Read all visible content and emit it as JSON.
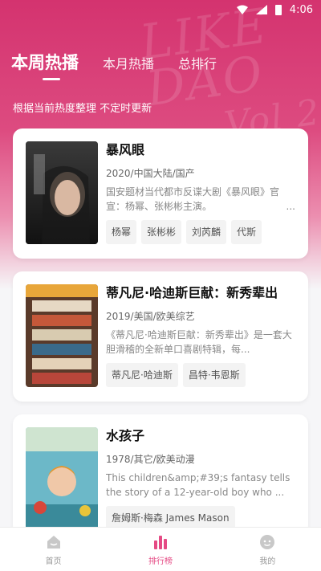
{
  "status_bar": {
    "time": "4:06",
    "icons": [
      "wifi-icon",
      "signal-icon",
      "battery-icon"
    ]
  },
  "hero": {
    "decoration_text": [
      "LIKE",
      "DAO",
      "Vol 2"
    ]
  },
  "tabs": [
    {
      "label": "本周热播",
      "active": true
    },
    {
      "label": "本月热播",
      "active": false
    },
    {
      "label": "总排行",
      "active": false
    }
  ],
  "subtitle": "根据当前热度整理 不定时更新",
  "colors": {
    "accent": "#e54a84",
    "hero_top": "#d4336f"
  },
  "items": [
    {
      "title": "暴风眼",
      "meta": "2020/中国大陆/国产",
      "desc": "国安题材当代都市反谍大剧《暴风眼》官宣：杨幂、张彬彬主演。",
      "tags": [
        "杨幂",
        "张彬彬",
        "刘芮麟",
        "代斯"
      ]
    },
    {
      "title": "蒂凡尼·哈迪斯巨献：新秀辈出",
      "meta": "2019/美国/欧美综艺",
      "desc": "《蒂凡尼·哈迪斯巨献：新秀辈出》是一套大胆滑稽的全新单口喜剧特辑，每...",
      "tags": [
        "蒂凡尼·哈迪斯",
        "昌特·韦恩斯"
      ]
    },
    {
      "title": "水孩子",
      "meta": "1978/其它/欧美动漫",
      "desc": "This children&amp;#39;s fantasy tells the story of a 12-year-old boy who ...",
      "tags": [
        "詹姆斯·梅森 James Mason"
      ]
    }
  ],
  "bottom_nav": [
    {
      "label": "首页",
      "icon": "home-icon",
      "active": false
    },
    {
      "label": "排行榜",
      "icon": "ranking-icon",
      "active": true
    },
    {
      "label": "我的",
      "icon": "profile-icon",
      "active": false
    }
  ]
}
